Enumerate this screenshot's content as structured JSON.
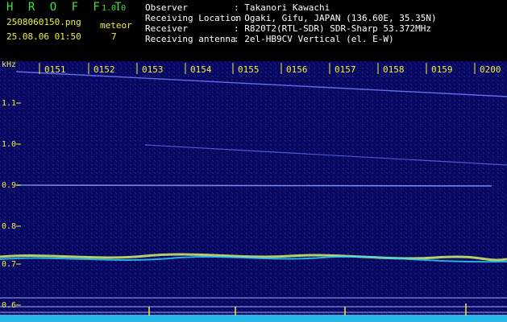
{
  "header": {
    "app_name": "H R O F F T",
    "version": "1.0.0",
    "filename": "2508060150.png",
    "datetime": "25.08.06 01:50",
    "meteor_label": "meteor",
    "meteor_count": "7",
    "info": [
      {
        "key": "Observer",
        "value": ": Takanori Kawachi"
      },
      {
        "key": "Receiving Location",
        "value": ": Ogaki, Gifu, JAPAN (136.60E, 35.35N)"
      },
      {
        "key": "Receiver",
        "value": ": R820T2(RTL-SDR) SDR-Sharp 53.372MHz"
      },
      {
        "key": "Receiving antenna",
        "value": ": 2el-HB9CV Vertical (el. E-W)"
      }
    ]
  },
  "spectrogram": {
    "unit_label": "kHz",
    "time_labels": [
      "0151",
      "0152",
      "0153",
      "0154",
      "0155",
      "0156",
      "0157",
      "0158",
      "0159",
      "0200"
    ],
    "freq_labels": [
      "1.1",
      "1.0",
      "0.9",
      "0.8",
      "0.7",
      "0.6"
    ],
    "colors": {
      "background": "#0a0a6a",
      "trace": "#7b8fff",
      "noise": "#2fd6ff",
      "burst": "#f0f03c",
      "label": "#f0f03c"
    }
  }
}
